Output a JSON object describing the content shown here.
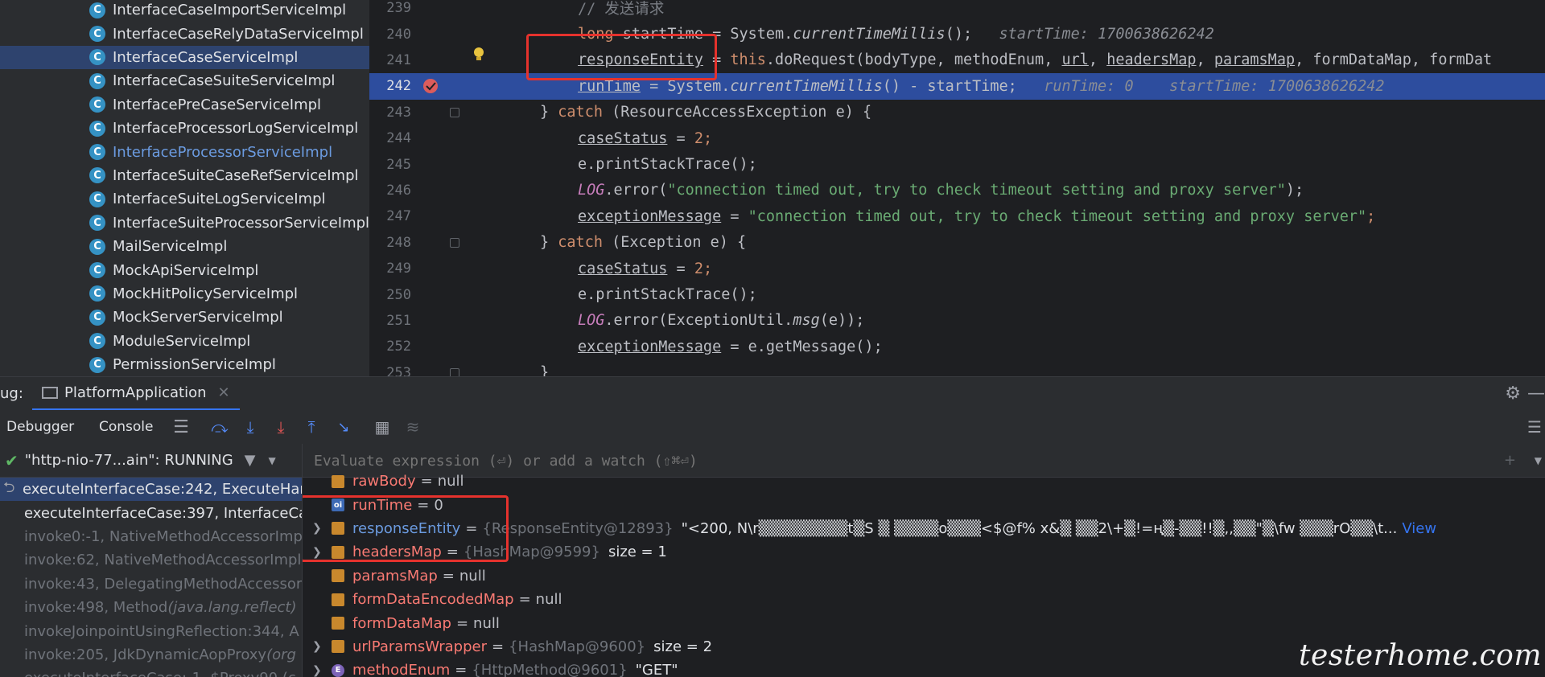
{
  "project_tree": {
    "items": [
      {
        "label": "InterfaceCaseImportServiceImpl"
      },
      {
        "label": "InterfaceCaseRelyDataServiceImpl"
      },
      {
        "label": "InterfaceCaseServiceImpl"
      },
      {
        "label": "InterfaceCaseSuiteServiceImpl"
      },
      {
        "label": "InterfacePreCaseServiceImpl"
      },
      {
        "label": "InterfaceProcessorLogServiceImpl"
      },
      {
        "label": "InterfaceProcessorServiceImpl"
      },
      {
        "label": "InterfaceSuiteCaseRefServiceImpl"
      },
      {
        "label": "InterfaceSuiteLogServiceImpl"
      },
      {
        "label": "InterfaceSuiteProcessorServiceImpl"
      },
      {
        "label": "MailServiceImpl"
      },
      {
        "label": "MockApiServiceImpl"
      },
      {
        "label": "MockHitPolicyServiceImpl"
      },
      {
        "label": "MockServerServiceImpl"
      },
      {
        "label": "ModuleServiceImpl"
      },
      {
        "label": "PermissionServiceImpl"
      }
    ]
  },
  "editor": {
    "line_numbers": [
      "239",
      "240",
      "241",
      "242",
      "243",
      "244",
      "245",
      "246",
      "247",
      "248",
      "249",
      "250",
      "251",
      "252",
      "253"
    ],
    "l239": "// 发送请求",
    "l240_a": "long ",
    "l240_b": "startTime",
    "l240_c": " = System.",
    "l240_d": "currentTimeMillis",
    "l240_e": "();",
    "l240_hint": "startTime: 1700638626242",
    "l241_a": "responseEntity",
    "l241_b": " = ",
    "l241_c": "this",
    "l241_d": ".doRequest(bodyType, methodEnum, ",
    "l241_e": "url",
    "l241_f": ", ",
    "l241_g": "headersMap",
    "l241_h": ", ",
    "l241_i": "paramsMap",
    "l241_j": ", formDataMap, formDat",
    "l242_a": "runTime",
    "l242_b": " = System.",
    "l242_c": "currentTimeMillis",
    "l242_d": "() - startTime;",
    "l242_hint1": "runTime: 0",
    "l242_hint2": "startTime: 1700638626242",
    "l243_a": "} ",
    "l243_b": "catch",
    "l243_c": " (ResourceAccessException e) {",
    "l244_a": "caseStatus",
    "l244_b": " = ",
    "l244_c": "2",
    "l244_d": ";",
    "l245": "e.printStackTrace();",
    "l246_a": "LOG",
    "l246_b": ".error(",
    "l246_c": "\"connection timed out, try to check timeout setting and proxy server\"",
    "l246_d": ");",
    "l247_a": "exceptionMessage",
    "l247_b": " = ",
    "l247_c": "\"connection timed out, try to check timeout setting and proxy server\"",
    "l247_d": ";",
    "l248_a": "} ",
    "l248_b": "catch",
    "l248_c": " (Exception e) {",
    "l249_a": "caseStatus",
    "l249_b": " = ",
    "l249_c": "2",
    "l249_d": ";",
    "l250": "e.printStackTrace();",
    "l251_a": "LOG",
    "l251_b": ".error(ExceptionUtil.",
    "l251_c": "msg",
    "l251_d": "(e));",
    "l252_a": "exceptionMessage",
    "l252_b": " = e.getMessage();",
    "l253": "}"
  },
  "debug": {
    "label": "ug:",
    "config_tab": "PlatformApplication",
    "tabs": {
      "debugger": "Debugger",
      "console": "Console"
    },
    "thread": "\"http-nio-77...ain\": RUNNING",
    "eval_placeholder": "Evaluate expression (⏎) or add a watch (⇧⌘⏎)"
  },
  "frames": [
    {
      "text": "executeInterfaceCase:242, ExecuteHar",
      "pkg": ""
    },
    {
      "text": "executeInterfaceCase:397, InterfaceCa",
      "pkg": ""
    },
    {
      "text": "invoke0:-1, NativeMethodAccessorImp",
      "pkg": ""
    },
    {
      "text": "invoke:62, NativeMethodAccessorImpl",
      "pkg": ""
    },
    {
      "text": "invoke:43, DelegatingMethodAccessor",
      "pkg": ""
    },
    {
      "text": "invoke:498, Method ",
      "pkg": "(java.lang.reflect)"
    },
    {
      "text": "invokeJoinpointUsingReflection:344, A",
      "pkg": ""
    },
    {
      "text": "invoke:205, JdkDynamicAopProxy ",
      "pkg": "(org"
    },
    {
      "text": "executeInterfaceCase:-1, $Proxy90 (c",
      "pkg": ""
    }
  ],
  "variables": [
    {
      "name": "rawBody",
      "type": "",
      "value": "null",
      "expandable": false,
      "icon": "field"
    },
    {
      "name": "runTime",
      "type": "",
      "value": "0",
      "expandable": false,
      "icon": "local"
    },
    {
      "name": "responseEntity",
      "type": "{ResponseEntity@12893}",
      "value": "\"<200, N\\r▒▒▒▒▒▒▒▒t▒S ▒ ▒▒▒▒o▒▒▒<$@f% x&▒ ▒▒2\\+▒!=ң▒-▒▒!!▒,,▒▒\"▒\\fw ▒▒▒rO▒▒\\t...",
      "link": "View",
      "expandable": true,
      "icon": "field"
    },
    {
      "name": "headersMap",
      "type": "{HashMap@9599}",
      "value": "size = 1",
      "expandable": true,
      "icon": "field"
    },
    {
      "name": "paramsMap",
      "type": "",
      "value": "null",
      "expandable": false,
      "icon": "field"
    },
    {
      "name": "formDataEncodedMap",
      "type": "",
      "value": "null",
      "expandable": false,
      "icon": "field"
    },
    {
      "name": "formDataMap",
      "type": "",
      "value": "null",
      "expandable": false,
      "icon": "field"
    },
    {
      "name": "urlParamsWrapper",
      "type": "{HashMap@9600}",
      "value": "size = 2",
      "expandable": true,
      "icon": "field"
    },
    {
      "name": "methodEnum",
      "type": "{HttpMethod@9601}",
      "value": "\"GET\"",
      "expandable": true,
      "icon": "enum"
    }
  ],
  "watermark": "testerhome.com",
  "colors": {
    "accent": "#3574f0",
    "highlight_box": "#e5322d",
    "exec_line": "#2d4d9e",
    "selected_row": "#2e436e"
  }
}
